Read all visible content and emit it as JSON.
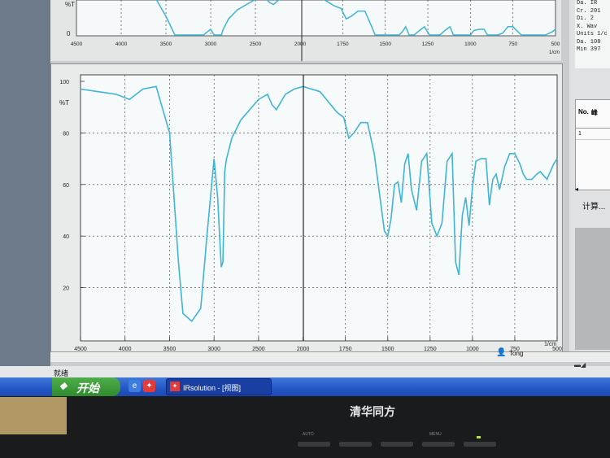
{
  "spectrum_top": {
    "x_ticks": [
      "4500",
      "4000",
      "3500",
      "3000",
      "2500",
      "2000",
      "1750",
      "1500",
      "1250",
      "1000",
      "750",
      "500"
    ],
    "x_unit": "1/cm",
    "y_label_zero": "0",
    "y_label_t": "%T"
  },
  "chart_data": {
    "type": "line",
    "ylabel": "%T",
    "xlabel": "1/cm",
    "x_ticks": [
      "4500",
      "4000",
      "3500",
      "3000",
      "2500",
      "2000",
      "1750",
      "1500",
      "1250",
      "1000",
      "750",
      "500"
    ],
    "y_ticks": [
      "100",
      "80",
      "60",
      "40",
      "20"
    ],
    "ylim": [
      0,
      100
    ],
    "series": [
      {
        "color": "#3fb4d6",
        "x": [
          4500,
          4300,
          4100,
          3950,
          3800,
          3650,
          3500,
          3400,
          3350,
          3250,
          3150,
          3080,
          3000,
          2960,
          2920,
          2900,
          2880,
          2860,
          2800,
          2700,
          2500,
          2400,
          2350,
          2300,
          2200,
          2100,
          2000,
          1900,
          1850,
          1800,
          1760,
          1730,
          1700,
          1660,
          1620,
          1580,
          1560,
          1520,
          1500,
          1480,
          1460,
          1440,
          1420,
          1400,
          1380,
          1360,
          1330,
          1300,
          1270,
          1240,
          1210,
          1180,
          1150,
          1120,
          1100,
          1080,
          1060,
          1040,
          1020,
          1000,
          980,
          950,
          920,
          900,
          880,
          860,
          840,
          810,
          780,
          750,
          720,
          700,
          680,
          650,
          620,
          600,
          560,
          520,
          500
        ],
        "y": [
          97,
          96,
          95,
          93,
          97,
          98,
          80,
          30,
          10,
          7,
          12,
          40,
          70,
          55,
          28,
          30,
          65,
          70,
          78,
          85,
          93,
          95,
          91,
          89,
          95,
          97,
          98,
          96,
          92,
          88,
          86,
          78,
          80,
          84,
          84,
          72,
          62,
          42,
          40,
          47,
          60,
          61,
          53,
          68,
          72,
          58,
          50,
          69,
          72,
          45,
          40,
          45,
          69,
          72,
          30,
          25,
          48,
          55,
          44,
          59,
          69,
          70,
          70,
          52,
          62,
          64,
          58,
          67,
          72,
          72,
          68,
          64,
          62,
          62,
          64,
          65,
          62,
          68,
          70
        ]
      }
    ]
  },
  "side_info": [
    "Da.  IR",
    "Cr.  201",
    "Di.  2",
    "X.   Wav",
    "Units 1/c",
    "Da.  108",
    "Min  397"
  ],
  "side_table": {
    "col1": "No.",
    "col2": "峰",
    "row1": "1"
  },
  "side_calc": "计算...",
  "status": {
    "user": "Tong",
    "ready": "就绪"
  },
  "taskbar": {
    "start": "开始",
    "task_label": "IRsolution - [视图]"
  },
  "monitor": {
    "brand": "清华同方",
    "btn_labels": [
      "AUTO",
      "",
      "",
      "MENU"
    ]
  }
}
